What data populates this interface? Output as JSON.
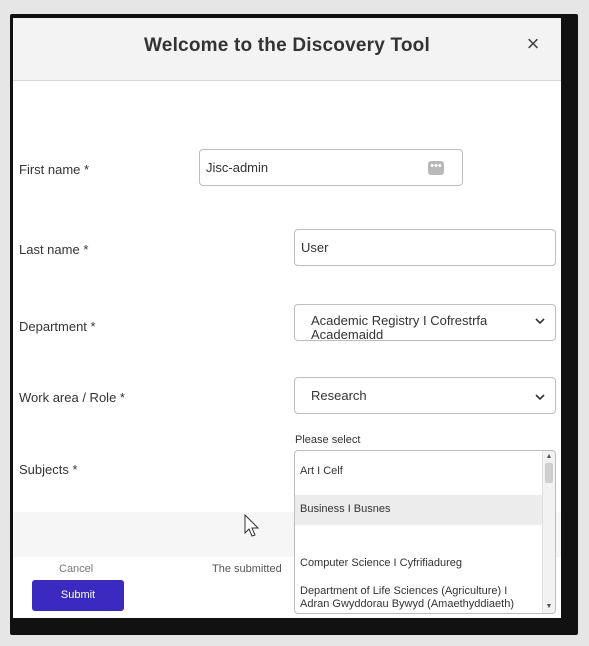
{
  "modal": {
    "title": "Welcome to the Discovery Tool",
    "close_icon": "close-icon"
  },
  "form": {
    "first_name": {
      "label": "First name *",
      "value": "Jisc-admin",
      "icon": "dots-icon"
    },
    "last_name": {
      "label": "Last name *",
      "value": "User"
    },
    "department": {
      "label": "Department *",
      "value_line1": "Academic Registry I Cofrestrfa",
      "value_line2": "Academaidd",
      "icon": "chevron-down-icon"
    },
    "work_area": {
      "label": "Work area / Role *",
      "value": "Research",
      "icon": "chevron-down-icon"
    },
    "subjects": {
      "label": "Subjects *",
      "hint": "Please select",
      "options": [
        "Art I Celf",
        "Business I Busnes",
        "Computer Science I Cyfrifiadureg",
        "Department of Life Sciences (Agriculture) I",
        "Adran Gwyddorau Bywyd (Amaethyddiaeth)"
      ],
      "highlighted_index": 1
    }
  },
  "footer": {
    "cancel_label": "Cancel",
    "submitted_note": "The submitted",
    "submit_label": "Submit"
  },
  "colors": {
    "primary_button": "#3a2ac0",
    "header_bg": "#f3f3f3"
  }
}
